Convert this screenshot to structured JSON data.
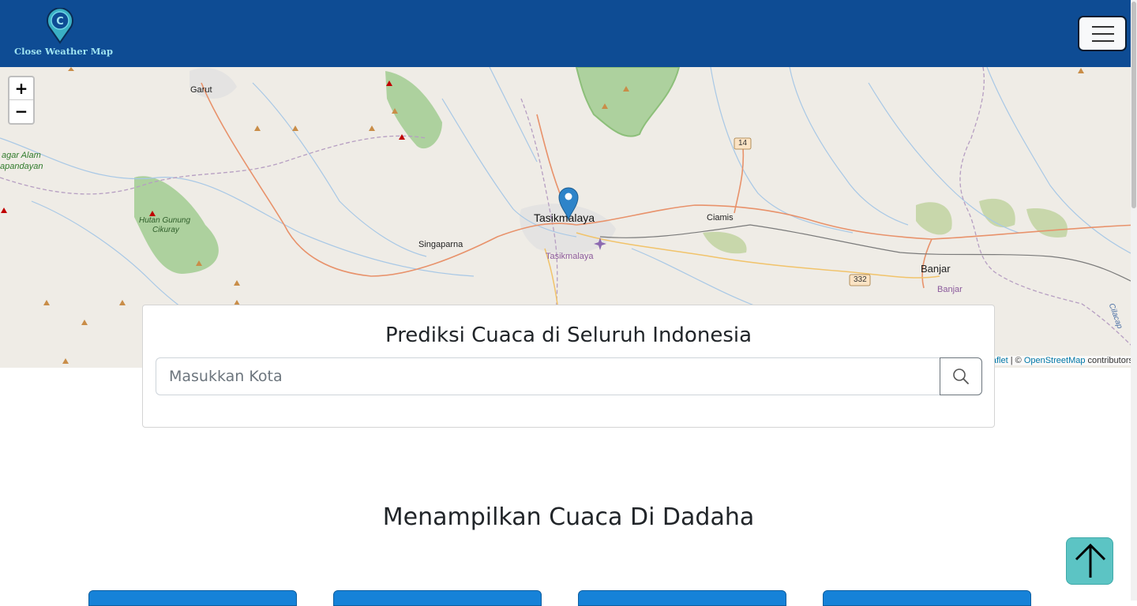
{
  "navbar": {
    "brand_text": "Close Weather Map",
    "logo_letter": "C",
    "logo_icon": "map-pin-logo",
    "toggle_icon": "hamburger-menu-icon",
    "background_color": "#0e4c94"
  },
  "map": {
    "zoom_in_label": "+",
    "zoom_out_label": "−",
    "places": {
      "garut": "Garut",
      "tasikmalaya": "Tasikmalaya",
      "tasikmalaya_district": "Tasikmalaya",
      "ciamis": "Ciamis",
      "singaparna": "Singaparna",
      "banjar": "Banjar",
      "banjar_district": "Banjar",
      "hutan_gunung_1": "Hutan Gunung",
      "hutan_gunung_2": "Cikuray",
      "cagar_alam_1": "agar Alam",
      "cagar_alam_2": "apandayan",
      "road_14": "14",
      "road_332": "332",
      "cilacap": "Cilacap"
    },
    "attribution": {
      "leaflet": "aflet",
      "separator": " | © ",
      "osm": "OpenStreetMap",
      "contributors": " contributors"
    },
    "marker_icon": "location-marker-icon"
  },
  "search": {
    "title": "Prediksi Cuaca di Seluruh Indonesia",
    "placeholder": "Masukkan Kota",
    "button_icon": "search-icon"
  },
  "section": {
    "title": "Menampilkan Cuaca Di Dadaha"
  },
  "back_to_top_icon": "arrow-up-icon"
}
